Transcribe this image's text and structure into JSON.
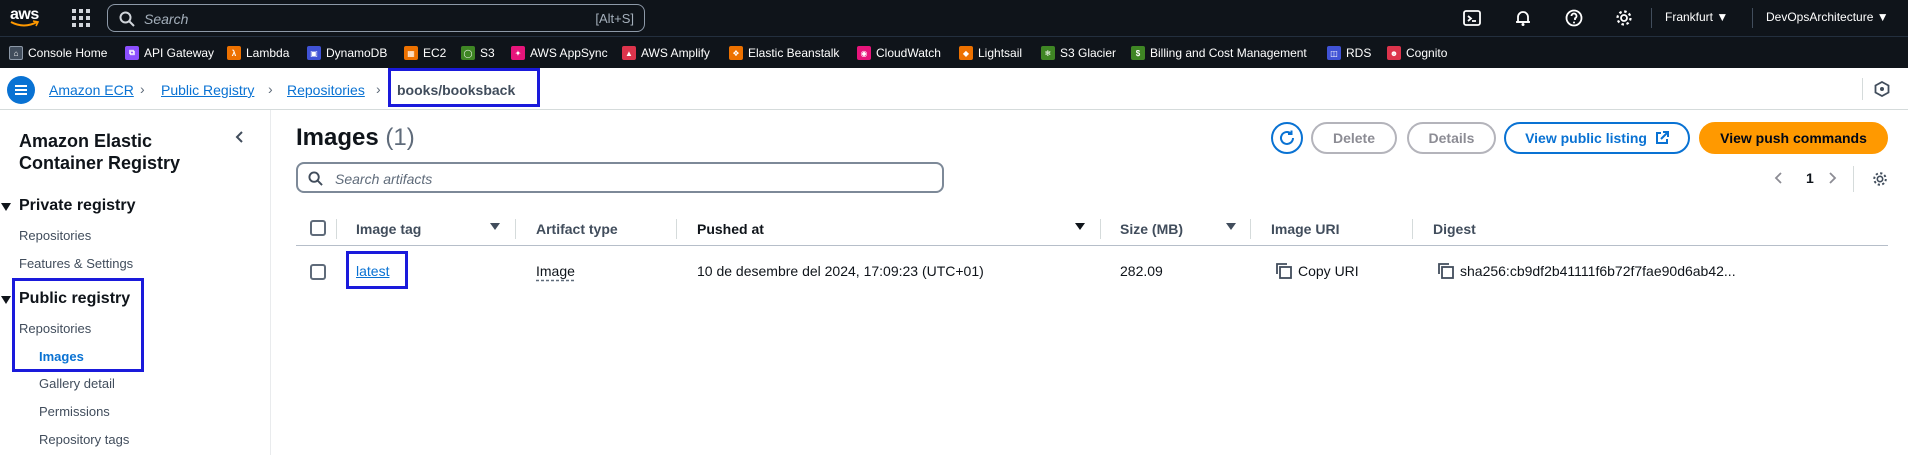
{
  "topbar": {
    "logo_text": "aws",
    "search_placeholder": "Search",
    "search_shortcut": "[Alt+S]",
    "region": "Frankfurt",
    "account": "DevOpsArchitecture"
  },
  "favorites": [
    {
      "label": "Console Home",
      "icon": "console-home-icon",
      "color": "#414d5c"
    },
    {
      "label": "API Gateway",
      "icon": "api-gateway-icon",
      "color": "#8c4fff"
    },
    {
      "label": "Lambda",
      "icon": "lambda-icon",
      "color": "#ed7100"
    },
    {
      "label": "DynamoDB",
      "icon": "dynamodb-icon",
      "color": "#4053d6"
    },
    {
      "label": "EC2",
      "icon": "ec2-icon",
      "color": "#ed7100"
    },
    {
      "label": "S3",
      "icon": "s3-icon",
      "color": "#3f8624"
    },
    {
      "label": "AWS AppSync",
      "icon": "appsync-icon",
      "color": "#e7157b"
    },
    {
      "label": "AWS Amplify",
      "icon": "amplify-icon",
      "color": "#dd344c"
    },
    {
      "label": "Elastic Beanstalk",
      "icon": "beanstalk-icon",
      "color": "#ed7100"
    },
    {
      "label": "CloudWatch",
      "icon": "cloudwatch-icon",
      "color": "#e7157b"
    },
    {
      "label": "Lightsail",
      "icon": "lightsail-icon",
      "color": "#ed7100"
    },
    {
      "label": "S3 Glacier",
      "icon": "glacier-icon",
      "color": "#3f8624"
    },
    {
      "label": "Billing and Cost Management",
      "icon": "billing-icon",
      "color": "#3f8624"
    },
    {
      "label": "RDS",
      "icon": "rds-icon",
      "color": "#4053d6"
    },
    {
      "label": "Cognito",
      "icon": "cognito-icon",
      "color": "#dd344c"
    }
  ],
  "breadcrumb": {
    "items": [
      "Amazon ECR",
      "Public Registry",
      "Repositories"
    ],
    "current": "books/booksback"
  },
  "sidenav": {
    "title": "Amazon Elastic Container Registry",
    "private_section": "Private registry",
    "private_items": [
      "Repositories",
      "Features & Settings"
    ],
    "public_section": "Public registry",
    "public_items": [
      "Repositories",
      "Images",
      "Gallery detail",
      "Permissions",
      "Repository tags"
    ]
  },
  "main": {
    "title": "Images",
    "count": "(1)",
    "buttons": {
      "delete": "Delete",
      "details": "Details",
      "view_public_listing": "View public listing",
      "view_push_commands": "View push commands"
    },
    "search_placeholder": "Search artifacts",
    "page": "1",
    "columns": [
      "Image tag",
      "Artifact type",
      "Pushed at",
      "Size (MB)",
      "Image URI",
      "Digest"
    ],
    "rows": [
      {
        "image_tag": "latest",
        "artifact_type": "Image",
        "pushed_at": "10 de desembre del 2024, 17:09:23 (UTC+01)",
        "size": "282.09",
        "image_uri": "Copy URI",
        "digest": "sha256:cb9df2b41111f6b72f7fae90d6ab42..."
      }
    ]
  },
  "colors": {
    "accent": "#0972d3",
    "orange": "#ff9900",
    "highlight_box": "#1a1adb",
    "topbar": "#0f141a"
  }
}
